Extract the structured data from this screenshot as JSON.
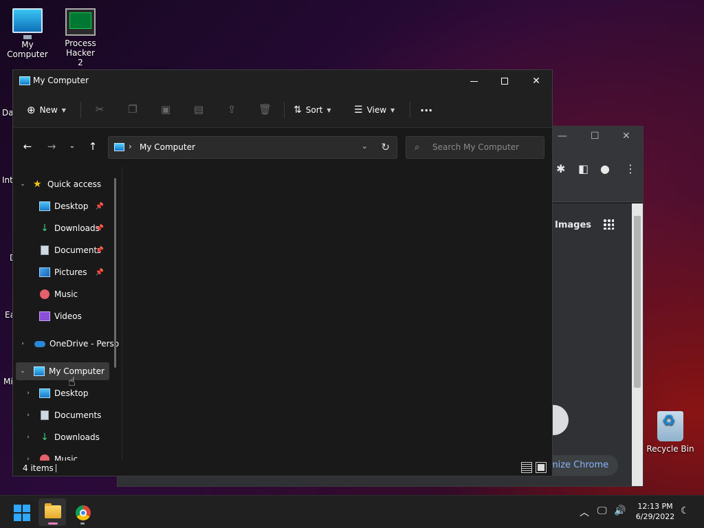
{
  "desktop": {
    "icons": [
      {
        "label": "My Computer"
      },
      {
        "label": "Process Hacker 2"
      },
      {
        "label": "Recycle Bin"
      }
    ],
    "edge_labels": [
      "Dat",
      "Inte",
      "D",
      "Ea",
      "Mi"
    ]
  },
  "chrome": {
    "images_link": "Images",
    "customize_button": "omize Chrome"
  },
  "explorer": {
    "title": "My Computer",
    "commandbar": {
      "new_label": "New",
      "sort_label": "Sort",
      "view_label": "View",
      "more_label": "···"
    },
    "address": {
      "path": "My Computer",
      "search_placeholder": "Search My Computer"
    },
    "nav": {
      "quick_access": "Quick access",
      "quick_items": [
        {
          "label": "Desktop",
          "pinned": true
        },
        {
          "label": "Downloads",
          "pinned": true
        },
        {
          "label": "Documents",
          "pinned": true
        },
        {
          "label": "Pictures",
          "pinned": true
        },
        {
          "label": "Music",
          "pinned": false
        },
        {
          "label": "Videos",
          "pinned": false
        }
      ],
      "onedrive": "OneDrive - Perso",
      "my_computer": "My Computer",
      "pc_items": [
        {
          "label": "Desktop"
        },
        {
          "label": "Documents"
        },
        {
          "label": "Downloads"
        },
        {
          "label": "Music"
        }
      ]
    },
    "status": {
      "item_count": "4 items"
    }
  },
  "taskbar": {
    "time": "12:13 PM",
    "date": "6/29/2022"
  },
  "colors": {
    "accent": "#2fa8ff",
    "explorer_bg": "#191919",
    "chrome_link": "#8ab4f8"
  }
}
